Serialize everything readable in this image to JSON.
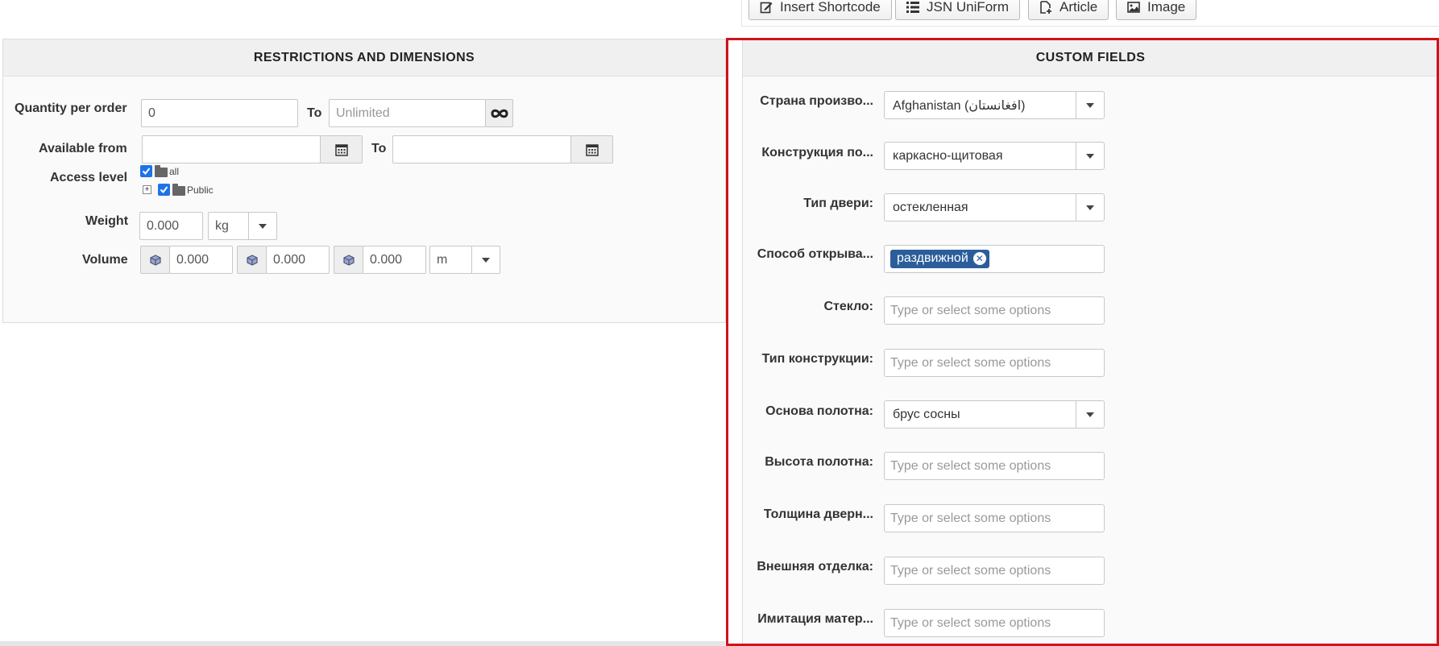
{
  "toolbar": {
    "buttons": [
      {
        "label": "Insert Shortcode",
        "icon": "edit-icon"
      },
      {
        "label": "JSN UniForm",
        "icon": "list-icon"
      },
      {
        "label": "Article",
        "icon": "file-add-icon"
      },
      {
        "label": "Image",
        "icon": "image-icon"
      }
    ]
  },
  "restrictions": {
    "title": "RESTRICTIONS AND DIMENSIONS",
    "quantity_label": "Quantity per order",
    "quantity_from": "0",
    "to_label": "To",
    "quantity_to_placeholder": "Unlimited",
    "available_label": "Available from",
    "available_from": "",
    "available_to": "",
    "access_label": "Access level",
    "access_tree": [
      {
        "label": "all",
        "checked": true
      },
      {
        "label": "Public",
        "checked": true
      }
    ],
    "weight_label": "Weight",
    "weight_value": "0.000",
    "weight_unit": "kg",
    "volume_label": "Volume",
    "volume_values": [
      "0.000",
      "0.000",
      "0.000"
    ],
    "volume_unit": "m"
  },
  "custom_fields": {
    "title": "CUSTOM FIELDS",
    "placeholder": "Type or select some options",
    "fields": [
      {
        "label": "Страна произво...",
        "kind": "select",
        "value": "Afghanistan (افغانستان)"
      },
      {
        "label": "Конструкция по...",
        "kind": "select",
        "value": "каркасно-щитовая"
      },
      {
        "label": "Тип двери:",
        "kind": "select",
        "value": "остекленная"
      },
      {
        "label": "Способ открыва...",
        "kind": "tags",
        "tags": [
          "раздвижной"
        ]
      },
      {
        "label": "Стекло:",
        "kind": "multi"
      },
      {
        "label": "Тип конструкции:",
        "kind": "multi"
      },
      {
        "label": "Основа полотна:",
        "kind": "select",
        "value": "брус сосны"
      },
      {
        "label": "Высота полотна:",
        "kind": "multi"
      },
      {
        "label": "Толщина дверн...",
        "kind": "multi"
      },
      {
        "label": "Внешняя отделка:",
        "kind": "multi"
      },
      {
        "label": "Имитация матер...",
        "kind": "multi"
      }
    ]
  },
  "colors": {
    "highlight": "#d0121b",
    "tag": "#2b5d9b",
    "checkbox": "#1e73e8"
  }
}
